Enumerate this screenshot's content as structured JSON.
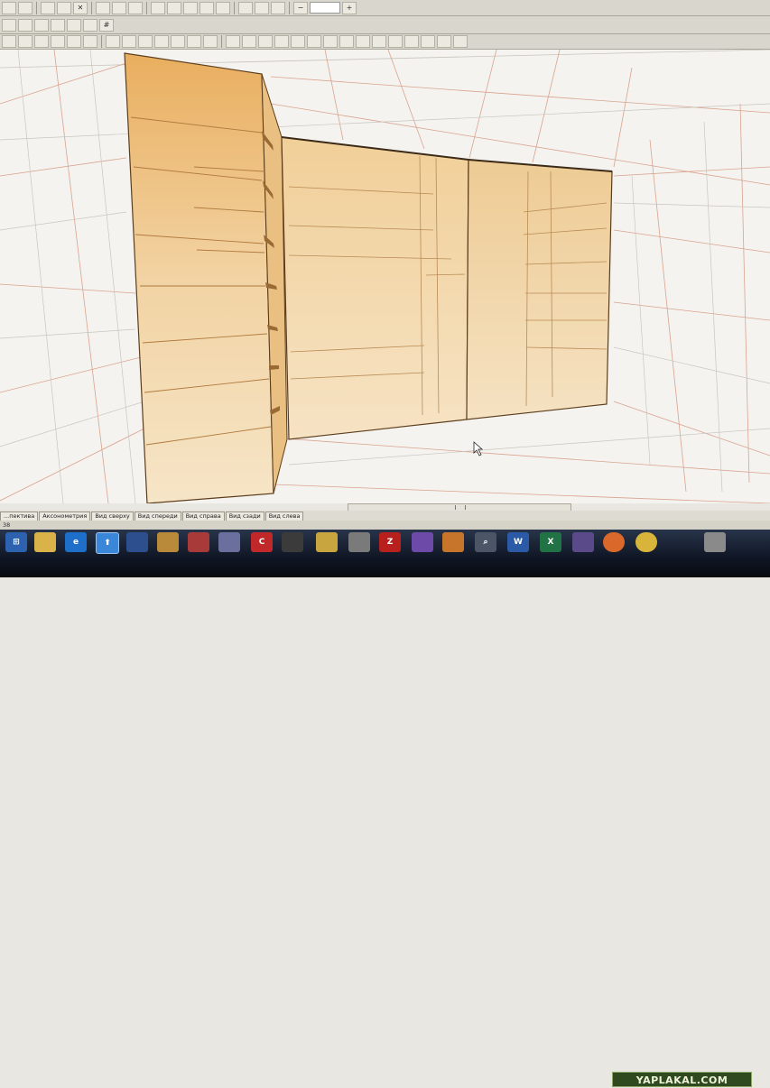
{
  "viewport": {
    "colors": {
      "background": "#f4f3ef",
      "wood": "#e8b46a",
      "grid": "#d9a38f"
    }
  },
  "toolbar": {
    "zoom_value": ""
  },
  "view_tabs": [
    "...пективa",
    "Аксонометрия",
    "Вид сверху",
    "Вид спереди",
    "Вид справа",
    "Вид сзади",
    "Вид слева"
  ],
  "status": {
    "text": "38"
  },
  "taskbar": {
    "icons": [
      "start-icon",
      "folder-icon",
      "ie-icon",
      "media-icon",
      "app-icon",
      "settings-icon",
      "pdf-icon",
      "note-icon",
      "cad-icon",
      "game-icon",
      "doc-icon",
      "printer-icon",
      "filezilla-icon",
      "viewer-icon",
      "paint-icon",
      "search-icon",
      "word-icon",
      "excel-icon",
      "pen-icon",
      "firefox-icon",
      "chrome-icon",
      "tray-icon"
    ]
  },
  "watermark": {
    "text": "YAPLAKAL.COM"
  }
}
